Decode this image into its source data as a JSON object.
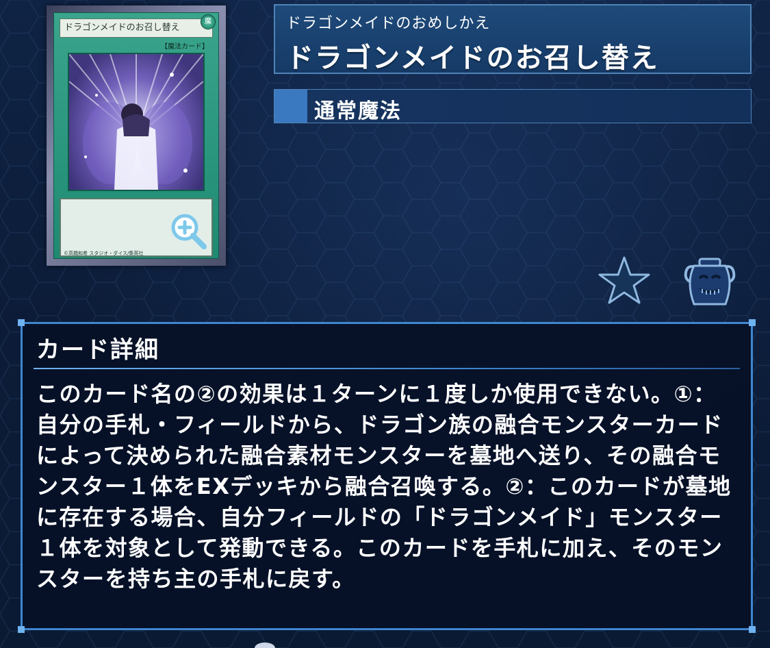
{
  "card": {
    "name_on_card": "ドラゴンメイドのお召し替え",
    "attribute_glyph": "魔",
    "type_on_card": "【魔法カード】",
    "copyright": "©高橋和希 スタジオ・ダイス/集英社"
  },
  "header": {
    "reading": "ドラゴンメイドのおめしかえ",
    "title": "ドラゴンメイドのお召し替え",
    "card_type": "通常魔法"
  },
  "detail": {
    "heading": "カード詳細",
    "text": "このカード名の②の効果は１ターンに１度しか使用できない。①：自分の手札・フィールドから、ドラゴン族の融合モンスターカードによって決められた融合素材モンスターを墓地へ送り、その融合モンスター１体をEXデッキから融合召喚する。②：このカードが墓地に存在する場合、自分フィールドの「ドラゴンメイド」モンスター１体を対象として発動できる。このカードを手札に加え、そのモンスターを持ち主の手札に戻す。"
  },
  "icons": {
    "zoom": "zoom-in-icon",
    "favorite": "star-icon",
    "pot": "pot-of-greed-icon"
  },
  "colors": {
    "panel_fill": "#1e4a7a",
    "panel_border": "#4f84b8",
    "accent": "#3f86d0",
    "spell_card": "#1f8a72"
  }
}
